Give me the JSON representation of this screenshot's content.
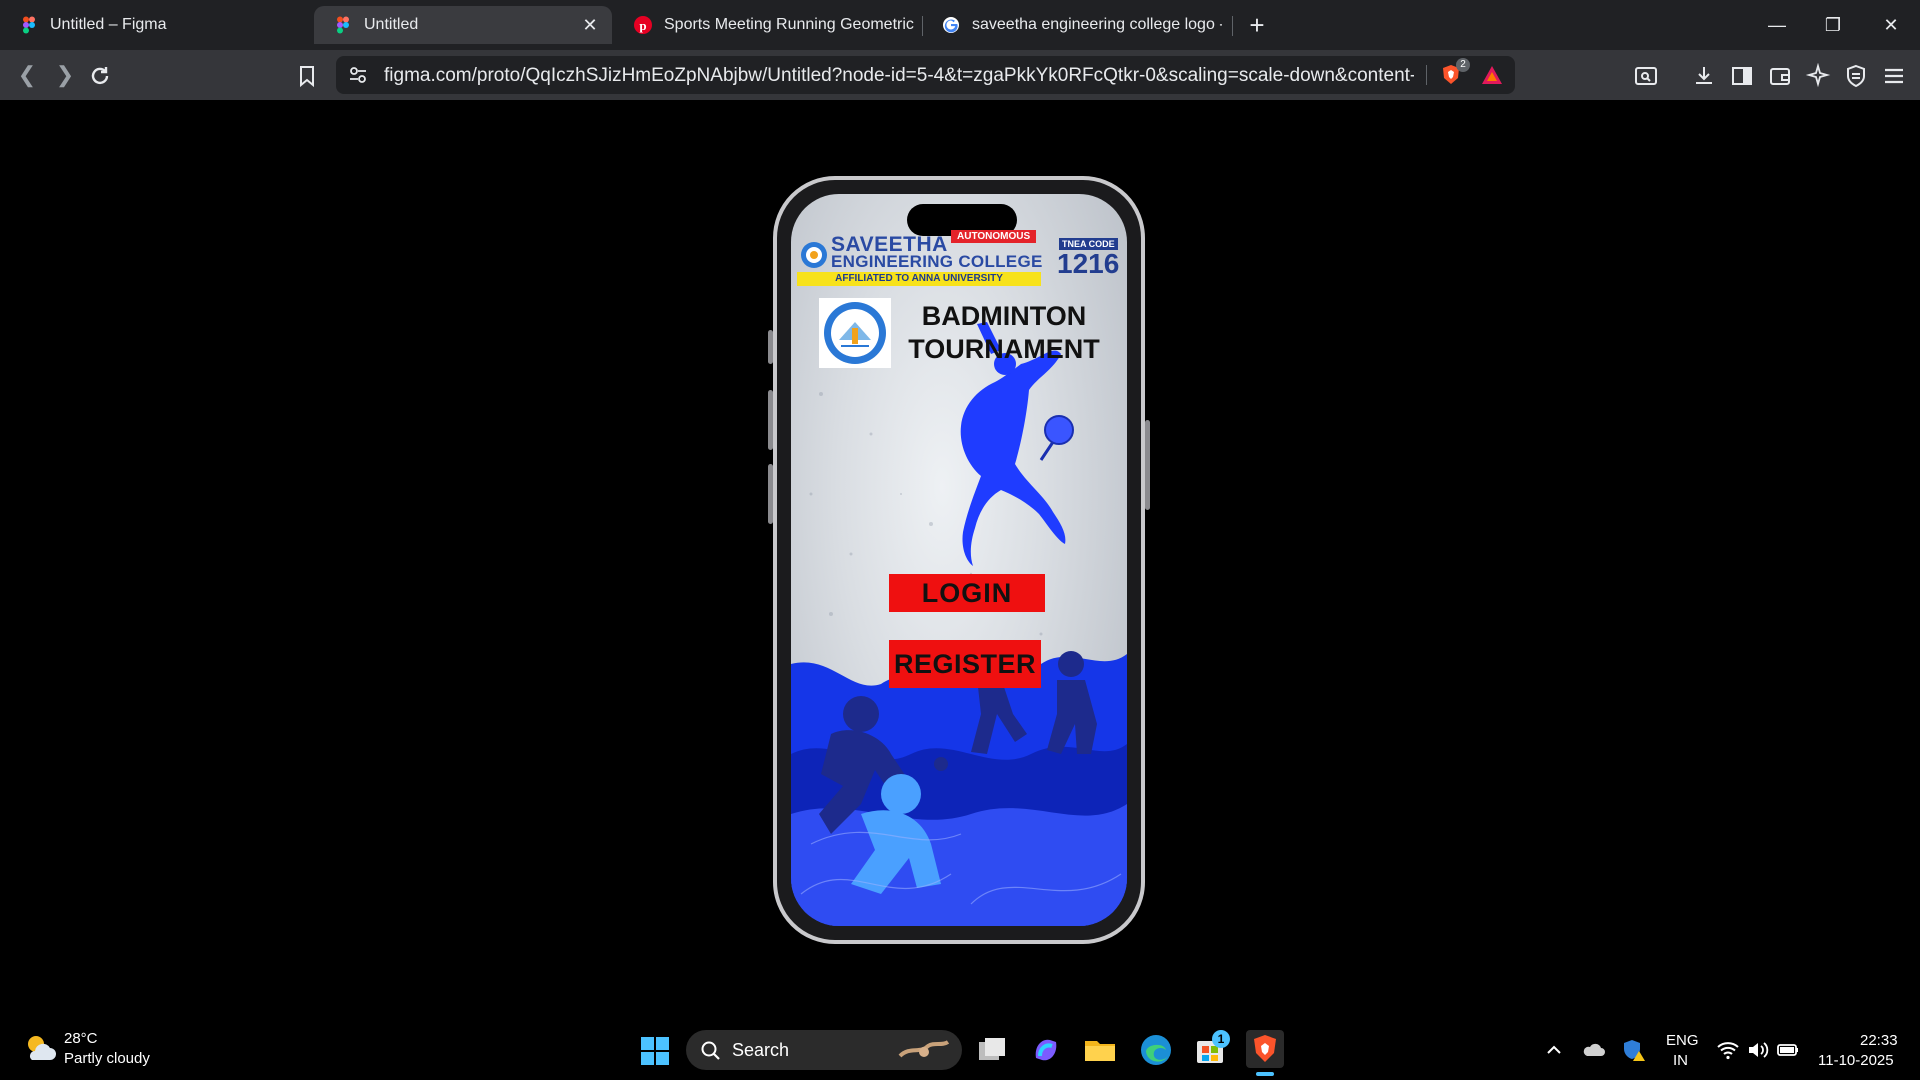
{
  "browser": {
    "tabs": [
      {
        "title": "Untitled – Figma",
        "icon": "figma-icon",
        "active": false
      },
      {
        "title": "Untitled",
        "icon": "figma-icon",
        "active": true
      },
      {
        "title": "Sports Meeting Running Geometric V",
        "icon": "pinterest-icon",
        "active": false
      },
      {
        "title": "saveetha engineering college logo - (",
        "icon": "google-icon",
        "active": false
      }
    ],
    "close_tab_glyph": "✕",
    "new_tab_glyph": "+",
    "url": "figma.com/proto/QqIczhSJizHmEoZpNAbjbw/Untitled?node-id=5-4&t=zgaPkkYk0RFcQtkr-0&scaling=scale-down&content-scalin...",
    "brave_shield_count": "2"
  },
  "prototype": {
    "college": {
      "name_line1": "SAVEETHA",
      "name_line2": "ENGINEERING COLLEGE",
      "autonomous": "AUTONOMOUS",
      "affiliation": "AFFILIATED TO ANNA UNIVERSITY",
      "tnea_label": "TNEA CODE",
      "tnea_code": "1216"
    },
    "event_title_line1": "BADMINTON",
    "event_title_line2": "TOURNAMENT",
    "login_label": "LOGIN",
    "register_label": "REGISTER"
  },
  "taskbar": {
    "weather_temp": "28°C",
    "weather_desc": "Partly cloudy",
    "search_label": "Search",
    "store_badge": "1",
    "lang_line1": "ENG",
    "lang_line2": "IN",
    "time": "22:33",
    "date": "11-10-2025"
  },
  "colors": {
    "tab_bg": "#202124",
    "toolbar_bg": "#35363a",
    "button_red": "#ef1010",
    "college_blue": "#2a4aa3",
    "silhouette_blue": "#1f3cff"
  }
}
